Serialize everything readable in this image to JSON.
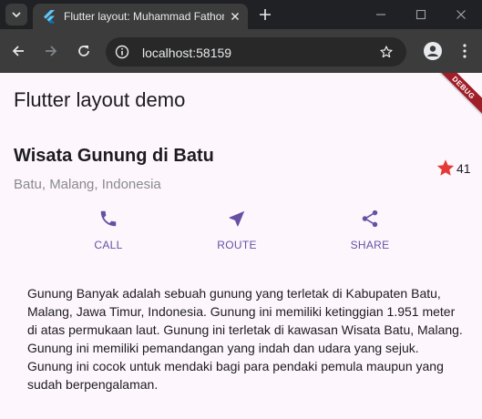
{
  "browser": {
    "tab_title": "Flutter layout: Muhammad Fathoni",
    "url": "localhost:58159"
  },
  "app": {
    "title": "Flutter layout demo",
    "debug_banner": "DEBUG"
  },
  "place": {
    "name": "Wisata Gunung di Batu",
    "location": "Batu, Malang, Indonesia",
    "rating_count": "41"
  },
  "actions": [
    {
      "label": "CALL",
      "icon": "phone-icon"
    },
    {
      "label": "ROUTE",
      "icon": "near-me-icon"
    },
    {
      "label": "SHARE",
      "icon": "share-icon"
    }
  ],
  "description": "Gunung Banyak adalah sebuah gunung yang terletak di Kabupaten Batu, Malang, Jawa Timur, Indonesia. Gunung ini memiliki ketinggian 1.951 meter di atas permukaan laut. Gunung ini terletak di kawasan Wisata Batu, Malang. Gunung ini memiliki pemandangan yang indah dan udara yang sejuk. Gunung ini cocok untuk mendaki bagi para pendaki pemula maupun yang sudah berpengalaman.",
  "colors": {
    "accent": "#6750a4",
    "star": "#e53935",
    "page_background": "#fdf7fd",
    "browser_frame": "#202124",
    "browser_toolbar": "#3c3c3c"
  }
}
